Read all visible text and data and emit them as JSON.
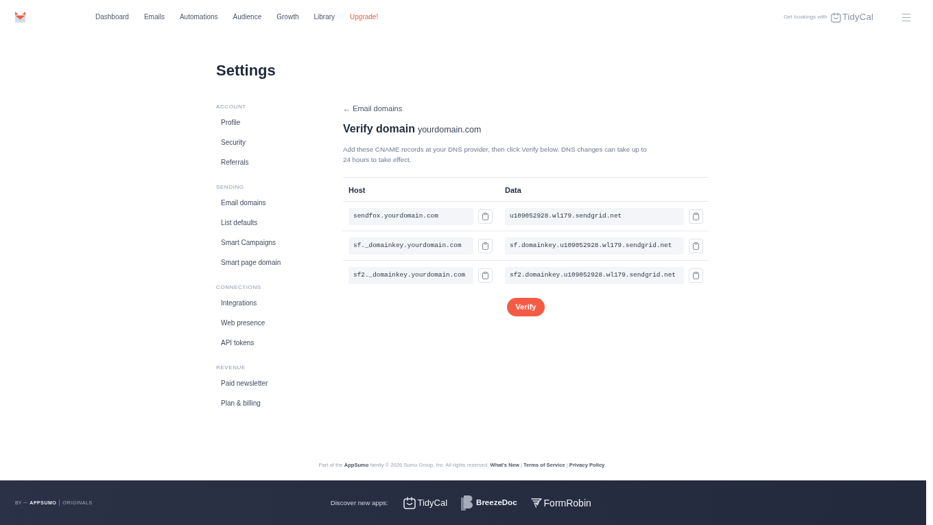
{
  "header": {
    "nav": [
      {
        "label": "Dashboard",
        "accent": false
      },
      {
        "label": "Emails",
        "accent": false
      },
      {
        "label": "Automations",
        "accent": false
      },
      {
        "label": "Audience",
        "accent": false
      },
      {
        "label": "Growth",
        "accent": false
      },
      {
        "label": "Library",
        "accent": false
      },
      {
        "label": "Upgrade!",
        "accent": true
      }
    ],
    "promo": {
      "text": "Get bookings with",
      "brand": "TidyCal"
    }
  },
  "page_title": "Settings",
  "sidebar": {
    "sections": [
      {
        "title": "ACCOUNT",
        "items": [
          "Profile",
          "Security",
          "Referrals"
        ]
      },
      {
        "title": "SENDING",
        "items": [
          "Email domains",
          "List defaults",
          "Smart Campaigns",
          "Smart page domain"
        ]
      },
      {
        "title": "CONNECTIONS",
        "items": [
          "Integrations",
          "Web presence",
          "API tokens"
        ]
      },
      {
        "title": "REVENUE",
        "items": [
          "Paid newsletter",
          "Plan & billing"
        ]
      }
    ]
  },
  "content": {
    "back_link": "← Email domains",
    "title": "Verify domain",
    "domain": "yourdomain.com",
    "description": "Add these CNAME records at your DNS provider, then click Verify below. DNS changes can take up to 24 hours to take effect.",
    "table": {
      "columns": [
        "Host",
        "Data"
      ],
      "rows": [
        {
          "host": "sendfox.yourdomain.com",
          "data": "u109052928.wl179.sendgrid.net"
        },
        {
          "host": "sf._domainkey.yourdomain.com",
          "data": "sf.domainkey.u109052928.wl179.sendgrid.net"
        },
        {
          "host": "sf2._domainkey.yourdomain.com",
          "data": "sf2.domainkey.u109052928.wl179.sendgrid.net"
        }
      ]
    },
    "verify_button": "Verify"
  },
  "footer": {
    "note": "Part of the **AppSumo** family © 2026 Sumo Group, Inc. All rights reserved.",
    "links": [
      "What's New",
      "Terms of Service",
      "Privacy Policy"
    ],
    "separator": "|",
    "end": "."
  },
  "bottom_bar": {
    "by": "BY",
    "brand": "APPSUMO",
    "tagline": "ORIGINALS",
    "discover": "Discover new apps:",
    "apps": [
      {
        "name": "TidyCal",
        "kind": "calendar"
      },
      {
        "name": "BreezeDoc",
        "kind": "document"
      },
      {
        "name": "FormRobin",
        "kind": "bird"
      }
    ]
  }
}
